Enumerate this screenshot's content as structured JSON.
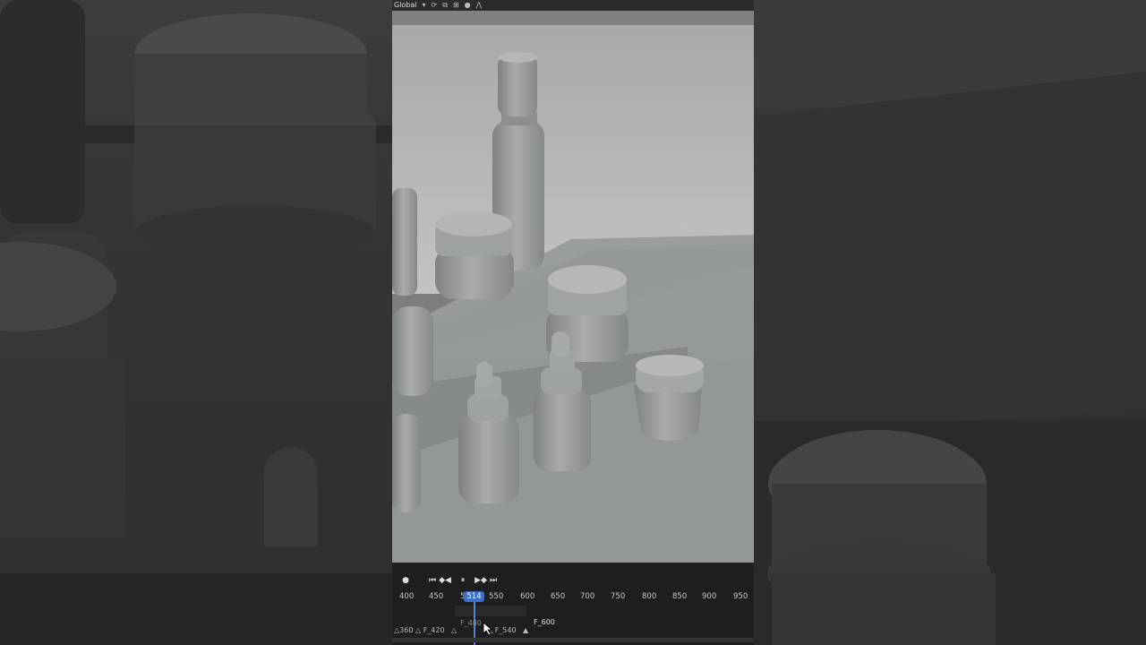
{
  "header": {
    "orientation": "Global"
  },
  "transport": {
    "record": "●",
    "jump_start": "⏮",
    "prev_key": "◆◀",
    "pause": "⏸",
    "next_key": "▶◆",
    "jump_end": "⏭"
  },
  "frames": {
    "ticks": [
      "400",
      "450",
      "5",
      "550",
      "600",
      "650",
      "700",
      "750",
      "800",
      "850",
      "900",
      "950"
    ],
    "current": "514"
  },
  "markers": {
    "m360": "360",
    "m420": "F_420",
    "m480": "F_480",
    "m540": "F_540",
    "m600": "F_600"
  },
  "colors": {
    "playhead": "#4f83d6",
    "viewport_bg": "#7b7e7c"
  }
}
